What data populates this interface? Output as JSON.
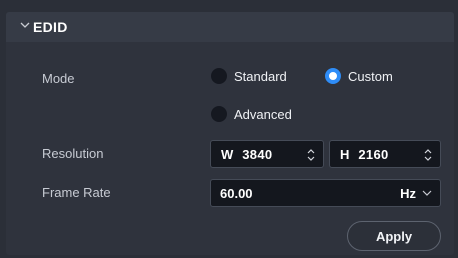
{
  "section": {
    "title": "EDID"
  },
  "mode": {
    "label": "Mode",
    "options": [
      {
        "label": "Standard",
        "selected": false
      },
      {
        "label": "Custom",
        "selected": true
      },
      {
        "label": "Advanced",
        "selected": false
      }
    ]
  },
  "resolution": {
    "label": "Resolution",
    "width_prefix": "W",
    "width_value": "3840",
    "height_prefix": "H",
    "height_value": "2160"
  },
  "frame_rate": {
    "label": "Frame Rate",
    "value": "60.00",
    "unit": "Hz"
  },
  "actions": {
    "apply_label": "Apply"
  },
  "colors": {
    "accent": "#2f8df7",
    "panel": "#2f333d",
    "field": "#14171e"
  }
}
